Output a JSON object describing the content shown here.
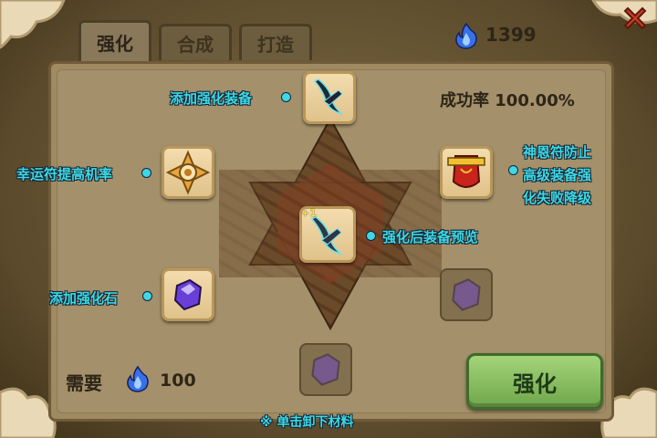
{
  "tabs": [
    {
      "label": "强化",
      "active": true
    },
    {
      "label": "合成",
      "active": false
    },
    {
      "label": "打造",
      "active": false
    }
  ],
  "currency": {
    "amount": "1399",
    "icon": "blue-flame-icon"
  },
  "success_rate": "成功率 100.00%",
  "labels": {
    "add_equipment": "添加强化装备",
    "lucky_charm": "幸运符提高机率",
    "protect_charm_1": "神恩符防止",
    "protect_charm_2": "高级装备强",
    "protect_charm_3": "化失败降级",
    "preview": "强化后装备预览",
    "add_stone": "添加强化石"
  },
  "preview_badge": "+1",
  "cost": {
    "label": "需要",
    "amount": "100"
  },
  "enhance_button": "强化",
  "hint": "※ 单击卸下材料",
  "colors": {
    "accent_cyan": "#3ed8e4",
    "button_green": "#6fa74a",
    "panel": "#a08a61"
  }
}
